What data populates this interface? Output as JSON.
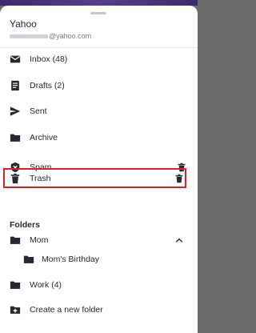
{
  "account": {
    "name": "Yahoo",
    "email_domain": "@yahoo.com"
  },
  "mailboxes": [
    {
      "label": "Inbox (48)",
      "icon": "inbox-icon"
    },
    {
      "label": "Drafts (2)",
      "icon": "drafts-icon"
    },
    {
      "label": "Sent",
      "icon": "sent-icon"
    },
    {
      "label": "Archive",
      "icon": "archive-folder-icon"
    },
    {
      "label": "Spam",
      "icon": "spam-shield-icon",
      "trailing": "trash-icon"
    },
    {
      "label": "Trash",
      "icon": "trash-icon",
      "trailing": "trash-icon",
      "selected": true
    }
  ],
  "folders": {
    "title": "Folders",
    "items": [
      {
        "label": "Mom",
        "icon": "folder-icon",
        "trailing": "chevron-up-icon"
      },
      {
        "label": "Mom's Birthday",
        "icon": "folder-icon"
      },
      {
        "label": "Work (4)",
        "icon": "folder-icon"
      }
    ],
    "create_label": "Create a new folder"
  },
  "colors": {
    "icon": "#232a31",
    "selection_outline": "#e01e26",
    "header_strip": "#4a3580"
  }
}
